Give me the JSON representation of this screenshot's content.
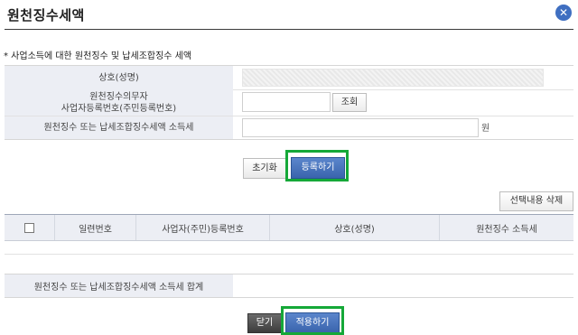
{
  "window": {
    "title": "원천징수세액",
    "close_icon": "close-icon",
    "accent_color": "#3f6fc1",
    "highlight_color": "#15a838"
  },
  "section": {
    "title": "* 사업소득에 대한 원천징수 및 납세조합징수 세액"
  },
  "form": {
    "company_label": "상호(성명)",
    "company_value": "",
    "bizno_label_line1": "원천징수의무자",
    "bizno_label_line2": "사업자등록번호(주민등록번호)",
    "bizno_value": "",
    "lookup_button": "조회",
    "tax_label": "원천징수 또는 납세조합징수세액 소득세",
    "tax_value": "",
    "tax_unit": "원"
  },
  "actions": {
    "reset_button": "초기화",
    "register_button": "등록하기",
    "delete_selected_button": "선택내용 삭제"
  },
  "grid": {
    "columns": [
      "",
      "일련번호",
      "사업자(주민)등록번호",
      "상호(성명)",
      "원천징수 소득세"
    ],
    "rows": []
  },
  "summary": {
    "label": "원천징수 또는 납세조합징수세액 소득세 합계",
    "value": ""
  },
  "footer": {
    "close_button": "닫기",
    "apply_button": "적용하기"
  }
}
